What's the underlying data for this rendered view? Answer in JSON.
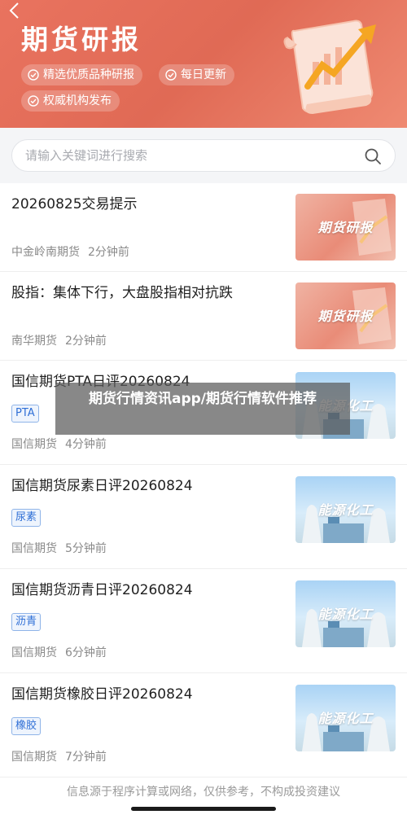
{
  "header": {
    "title": "期货研报",
    "tags": [
      "精选优质品种研报",
      "每日更新",
      "权威机构发布"
    ]
  },
  "search": {
    "placeholder": "请输入关键词进行搜索",
    "value": ""
  },
  "items": [
    {
      "title": "20260825交易提示",
      "tag": "",
      "source": "中金岭南期货",
      "time": "2分钟前",
      "thumb_label": "期货研报",
      "thumb_style": "red"
    },
    {
      "title": "股指：集体下行，大盘股指相对抗跌",
      "tag": "",
      "source": "南华期货",
      "time": "2分钟前",
      "thumb_label": "期货研报",
      "thumb_style": "red"
    },
    {
      "title": "国信期货PTA日评20260824",
      "tag": "PTA",
      "source": "国信期货",
      "time": "4分钟前",
      "thumb_label": "能源化工",
      "thumb_style": "blue"
    },
    {
      "title": "国信期货尿素日评20260824",
      "tag": "尿素",
      "source": "国信期货",
      "time": "5分钟前",
      "thumb_label": "能源化工",
      "thumb_style": "blue"
    },
    {
      "title": "国信期货沥青日评20260824",
      "tag": "沥青",
      "source": "国信期货",
      "time": "6分钟前",
      "thumb_label": "能源化工",
      "thumb_style": "blue"
    },
    {
      "title": "国信期货橡胶日评20260824",
      "tag": "橡胶",
      "source": "国信期货",
      "time": "7分钟前",
      "thumb_label": "能源化工",
      "thumb_style": "blue"
    }
  ],
  "overlay": {
    "text": "期货行情资讯app/期货行情软件推荐"
  },
  "footer": {
    "note": "信息源于程序计算或网络，仅供参考，不构成投资建议"
  },
  "colors": {
    "header_bg": "#e9735f",
    "tag_border": "#8fb4e8",
    "tag_text": "#2f6fd6"
  }
}
